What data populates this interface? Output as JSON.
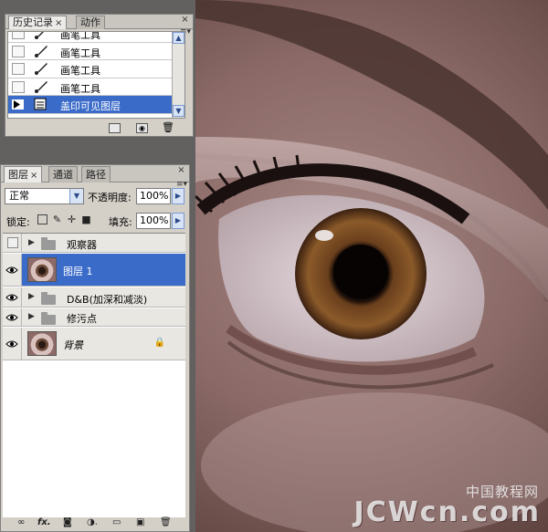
{
  "history_panel": {
    "tabs": [
      "历史记录",
      "动作"
    ],
    "close_glyph": "×",
    "items": [
      {
        "label": "画笔工具",
        "icon": "brush-icon",
        "selected": false
      },
      {
        "label": "画笔工具",
        "icon": "brush-icon",
        "selected": false
      },
      {
        "label": "画笔工具",
        "icon": "brush-icon",
        "selected": false
      },
      {
        "label": "画笔工具",
        "icon": "brush-icon",
        "selected": false
      },
      {
        "label": "盖印可见图层",
        "icon": "layer-stamp-icon",
        "selected": true
      }
    ]
  },
  "layers_panel": {
    "tabs": [
      "图层",
      "通道",
      "路径"
    ],
    "blend_mode": "正常",
    "opacity_label": "不透明度:",
    "opacity_value": "100%",
    "lock_label": "锁定:",
    "fill_label": "填充:",
    "fill_value": "100%",
    "layers": [
      {
        "name": "观察器",
        "type": "group",
        "visible": false,
        "selected": false
      },
      {
        "name": "图层 1",
        "type": "layer",
        "visible": true,
        "selected": true
      },
      {
        "name": "D&B(加深和减淡)",
        "type": "group",
        "visible": true,
        "selected": false
      },
      {
        "name": "修污点",
        "type": "group",
        "visible": true,
        "selected": false
      },
      {
        "name": "背景",
        "type": "layer",
        "visible": true,
        "selected": false,
        "locked": true
      }
    ],
    "footer_icons": [
      "link-icon",
      "fx-icon",
      "mask-icon",
      "adjustment-icon",
      "folder-icon",
      "new-layer-icon",
      "trash-icon"
    ]
  },
  "watermark": {
    "cn": "中国教程网",
    "en": "JCWcn.com"
  },
  "colors": {
    "selection": "#3a6bc9",
    "panel_bg": "#d4d0c8"
  }
}
